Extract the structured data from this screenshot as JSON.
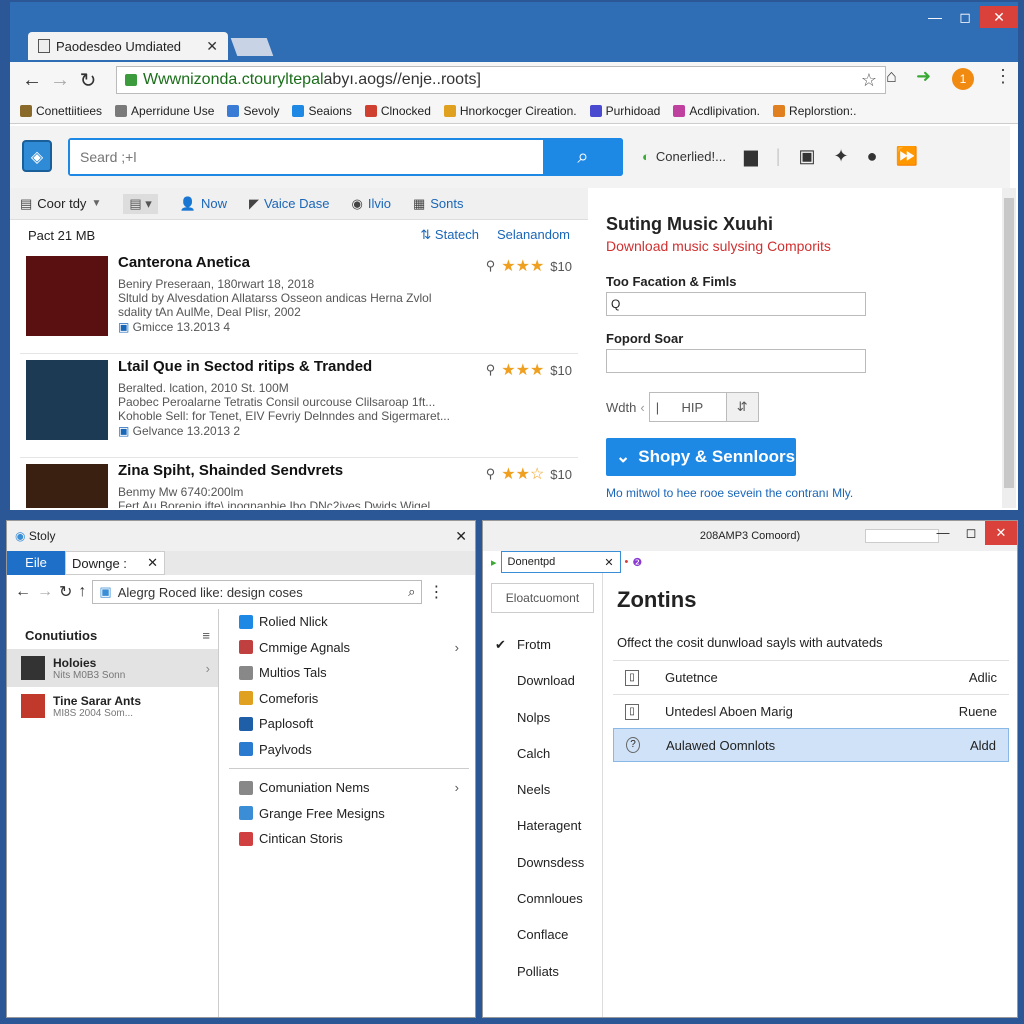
{
  "browser": {
    "tab_title": "Paodesdeo Umdiated",
    "tab_close": "✕",
    "window_controls": {
      "minimize": "—",
      "maximize": "◻",
      "close": "✕"
    },
    "url_host": "Wwwnizonda.ctouryltepal",
    "url_rest": "abyı.aogs//enje..roots]",
    "update_badge": "1",
    "bookmarks": [
      {
        "label": "Conettiitiees",
        "color": "#8a6a2a"
      },
      {
        "label": "Aperridune Use",
        "color": "#7a7a7a"
      },
      {
        "label": "Sevoly",
        "color": "#3a7bd5"
      },
      {
        "label": "Seaions",
        "color": "#1e88e5"
      },
      {
        "label": "Clnocked",
        "color": "#d04030"
      },
      {
        "label": "Hnorkocger Cireation.",
        "color": "#e0a020"
      },
      {
        "label": "Purhidoad",
        "color": "#4a4ad0"
      },
      {
        "label": "Acdlipivation.",
        "color": "#c040a0"
      },
      {
        "label": "Replorstion:.",
        "color": "#e08020"
      }
    ]
  },
  "site": {
    "search_placeholder": "Seard ;+l",
    "header_link": "Conerlied!...",
    "toolbar": [
      {
        "label": "Coor tdy",
        "icon": "sort-icon"
      },
      {
        "label": "Now",
        "icon": "person-icon"
      },
      {
        "label": "Vaice Dase",
        "icon": "tag-icon"
      },
      {
        "label": "Ilvio",
        "icon": "disc-icon"
      },
      {
        "label": "Sonts",
        "icon": "list-icon"
      }
    ],
    "result_count": "Pact 21 MB",
    "result_links": [
      "Statech",
      "Selanandom"
    ],
    "results": [
      {
        "title": "Canterona Anetica",
        "meta1": "Beniry Preseraan, 180rwart 18, 2018",
        "meta2": "Sltuld by Alvesdation Allatarss Osseon andicas Herna Zvlol",
        "meta3": "sdality tAn AulMe, Deal Plisr, 2002",
        "meta4": "Gmicce 13.2013 4",
        "stars": "★★★",
        "price": "$10",
        "thumb": "#5a1010"
      },
      {
        "title": "Ltail Que in Sectod ritips & Tranded",
        "meta1": "Beralted. lcation, 2010 St. 100M",
        "meta2": "Paobec Peroalarne Tetratis Consil ourcouse Clilsaroap 1ft...",
        "meta3": "Kohoble Sell: for Tenet, EIV Fevriy Delnndes and Sigermaret...",
        "meta4": "Gelvance 13.2013 2",
        "stars": "★★★",
        "price": "$10",
        "thumb": "#1d3a55"
      },
      {
        "title": "Zina Spiht, Shainded Sendvrets",
        "meta1": "Benmy Mw 6740:200lm",
        "meta2": "Fert Au Borenio ifte\\ inognanbie Ibo DNc2ives Dwids Wigel",
        "meta3": "",
        "meta4": "",
        "stars": "★★☆",
        "price": "$10",
        "thumb": "#3a2010"
      }
    ],
    "panel": {
      "title": "Suting Music Xuuhi",
      "subtitle": "Download music sulysing Comporits",
      "field1_label": "Too Facation & Fimls",
      "field1_value": "Q",
      "field2_label": "Fopord Soar",
      "field2_value": "",
      "width_label": "Wdth",
      "width_value": "HIP",
      "button": "Shopy & Sennloors",
      "note": "Mo mitwol to hee rooe sevein the contranı Mly."
    }
  },
  "explorer": {
    "title": "Stoly",
    "file_tab": "Eile",
    "tab2": "Downge :",
    "address": "Alegrg Roced like: design coses",
    "side_heading": "Conutiutios",
    "side_items": [
      {
        "t1": "Holoies",
        "t2": "Nits M0B3 Sonn"
      },
      {
        "t1": "Tine Sarar Ants",
        "t2": "MI8S 2004 Som..."
      }
    ],
    "menu1": [
      {
        "label": "Rolied Nlick",
        "color": "#1e88e5",
        "arrow": false
      },
      {
        "label": "Cmmige Agnals",
        "color": "#c04040",
        "arrow": true
      },
      {
        "label": "Multios Tals",
        "color": "#888",
        "arrow": false
      },
      {
        "label": "Comeforis",
        "color": "#e0a020",
        "arrow": false
      },
      {
        "label": "Paplosoft",
        "color": "#1e5fa8",
        "arrow": false
      },
      {
        "label": "Paylvods",
        "color": "#2a7ad0",
        "arrow": false
      }
    ],
    "menu2": [
      {
        "label": "Comuniation Nems",
        "color": "#888",
        "arrow": true
      },
      {
        "label": "Grange Free Mesigns",
        "color": "#3b8ed6",
        "arrow": false
      },
      {
        "label": "Cintican Storis",
        "color": "#d04040",
        "arrow": false
      }
    ]
  },
  "settings": {
    "title": "208AMP3 Comoord)",
    "tab": "Donentpd",
    "element_button": "Eloatcuomont",
    "nav": [
      "Frotm",
      "Download",
      "Nolps",
      "Calch",
      "Neels",
      "Hateragent",
      "Downsdess",
      "Comnloues",
      "Conflace",
      "Polliats"
    ],
    "heading": "Zontins",
    "description": "Offect the cosit dunwload sayls with autvateds",
    "rows": [
      {
        "label": "Gutetnce",
        "action": "Adlic",
        "icon": "▯"
      },
      {
        "label": "Untedesl Aboen Marig",
        "action": "Ruene",
        "icon": "▯"
      },
      {
        "label": "Aulawed Oomnlots",
        "action": "Aldd",
        "icon": "?"
      }
    ]
  }
}
